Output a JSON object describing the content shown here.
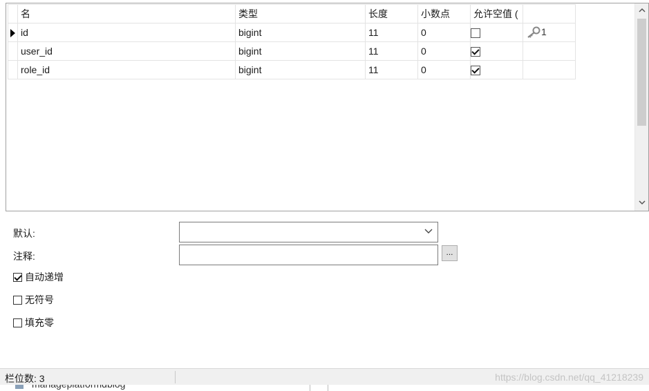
{
  "grid": {
    "columns": [
      "名",
      "类型",
      "长度",
      "小数点",
      "允许空值 (",
      ""
    ],
    "rows": [
      {
        "name": "id",
        "type": "bigint",
        "length": "11",
        "decimals": "0",
        "nullable": false,
        "key": "1",
        "selected": true
      },
      {
        "name": "user_id",
        "type": "bigint",
        "length": "11",
        "decimals": "0",
        "nullable": true,
        "key": "",
        "selected": false
      },
      {
        "name": "role_id",
        "type": "bigint",
        "length": "11",
        "decimals": "0",
        "nullable": true,
        "key": "",
        "selected": false
      }
    ]
  },
  "properties": {
    "default_label": "默认:",
    "default_value": "",
    "comment_label": "注释:",
    "comment_value": "",
    "ellipsis_label": "...",
    "auto_increment_label": "自动递增",
    "auto_increment": true,
    "unsigned_label": "无符号",
    "unsigned": false,
    "zerofill_label": "填充零",
    "zerofill": false
  },
  "status": {
    "field_count": "栏位数: 3",
    "watermark": "https://blog.csdn.net/qq_41218239"
  },
  "cut_off": {
    "text": "manageplatformdblog"
  },
  "icons": {
    "row_pointer": "row-pointer-icon",
    "key": "key-icon",
    "dropdown": "chevron-down-icon",
    "scroll_up": "scroll-up-icon",
    "scroll_down": "scroll-down-icon"
  }
}
